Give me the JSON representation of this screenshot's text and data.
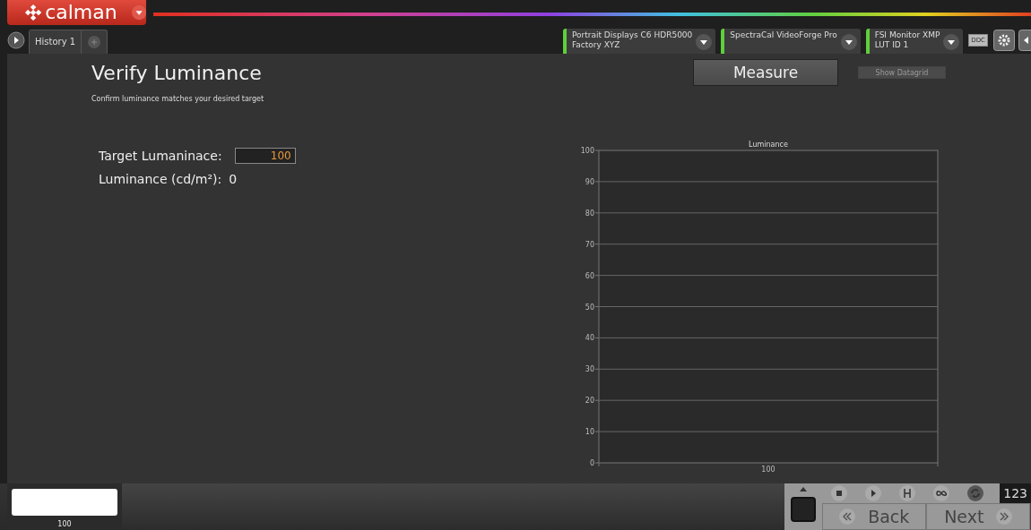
{
  "app": {
    "logo": "calman"
  },
  "tabs": [
    {
      "label": "History 1",
      "selected": true
    }
  ],
  "devices": [
    {
      "line1": "Portrait Displays C6 HDR5000",
      "line2": "Factory XYZ",
      "connected": true
    },
    {
      "line1": "SpectraCal VideoForge Pro",
      "connected": true
    },
    {
      "line1": "FSI Monitor XMP",
      "line2": "LUT ID 1",
      "connected": true
    }
  ],
  "ddc": "DDC",
  "page": {
    "title": "Verify Luminance",
    "subtitle": "Confirm luminance matches your desired target",
    "measure_button": "Measure",
    "datagrid_button": {
      "label": "Show Datagrid",
      "disabled": true
    },
    "target_label": "Target Lumaninace:",
    "target_value": "100",
    "luminance_label": "Luminance (cd/m²):",
    "luminance_value": "0"
  },
  "chart_data": {
    "type": "bar",
    "title": "Luminance",
    "categories": [
      "100"
    ],
    "values": [
      null
    ],
    "ylim": [
      0,
      100
    ],
    "grid": true,
    "yticks": [
      0,
      10,
      20,
      30,
      40,
      50,
      60,
      70,
      80,
      90,
      100
    ]
  },
  "swatches": [
    {
      "label": "100",
      "color": "#ffffff"
    }
  ],
  "controls": {
    "counter": "123",
    "back": "Back",
    "next": "Next"
  }
}
